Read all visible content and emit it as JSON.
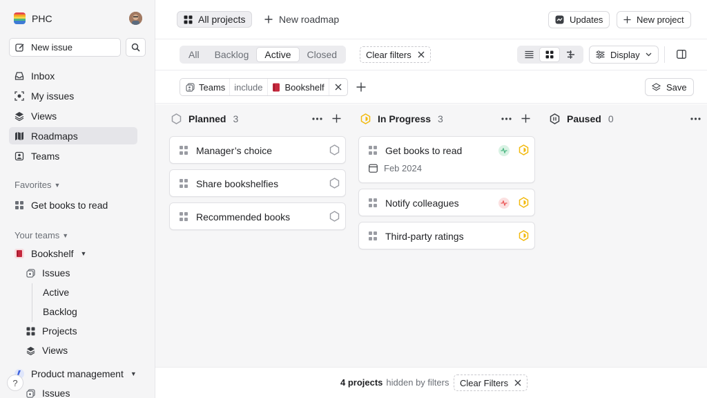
{
  "workspace": {
    "name": "PHC"
  },
  "sidebar": {
    "new_issue": "New issue",
    "nav": [
      {
        "label": "Inbox",
        "icon": "inbox-icon"
      },
      {
        "label": "My issues",
        "icon": "my-issues-icon"
      },
      {
        "label": "Views",
        "icon": "layers-icon"
      },
      {
        "label": "Roadmaps",
        "icon": "map-icon",
        "active": true
      },
      {
        "label": "Teams",
        "icon": "team-icon"
      }
    ],
    "favorites_label": "Favorites",
    "favorites": [
      {
        "label": "Get books to read"
      }
    ],
    "your_teams_label": "Your teams",
    "teams": [
      {
        "name": "Bookshelf",
        "items": [
          "Issues",
          "Active",
          "Backlog",
          "Projects",
          "Views"
        ]
      },
      {
        "name": "Product management",
        "items": [
          "Issues"
        ]
      }
    ],
    "help": "?"
  },
  "header": {
    "all_projects": "All projects",
    "new_roadmap": "New roadmap",
    "updates": "Updates",
    "new_project": "New project"
  },
  "filters": {
    "tabs": [
      "All",
      "Backlog",
      "Active",
      "Closed"
    ],
    "active_tab": "Active",
    "clear_filters": "Clear filters",
    "display": "Display",
    "chip": {
      "field": "Teams",
      "op": "include",
      "value": "Bookshelf"
    },
    "save": "Save"
  },
  "board": {
    "columns": [
      {
        "title": "Planned",
        "count": "3",
        "cards": [
          {
            "title": "Manager’s choice"
          },
          {
            "title": "Share bookshelfies"
          },
          {
            "title": "Recommended books"
          }
        ]
      },
      {
        "title": "In Progress",
        "count": "3",
        "cards": [
          {
            "title": "Get books to read",
            "date": "Feb 2024",
            "health": "on-track"
          },
          {
            "title": "Notify colleagues",
            "health": "off-track"
          },
          {
            "title": "Third-party ratings"
          }
        ]
      },
      {
        "title": "Paused",
        "count": "0",
        "cards": []
      }
    ]
  },
  "footer": {
    "hidden_count": "4 projects",
    "hidden_text": "hidden by filters",
    "clear_filters": "Clear Filters"
  },
  "colors": {
    "accent_yellow": "#f2b90c",
    "on_track": "#4cb782",
    "off_track": "#eb5757",
    "book_red": "#c5283d"
  }
}
